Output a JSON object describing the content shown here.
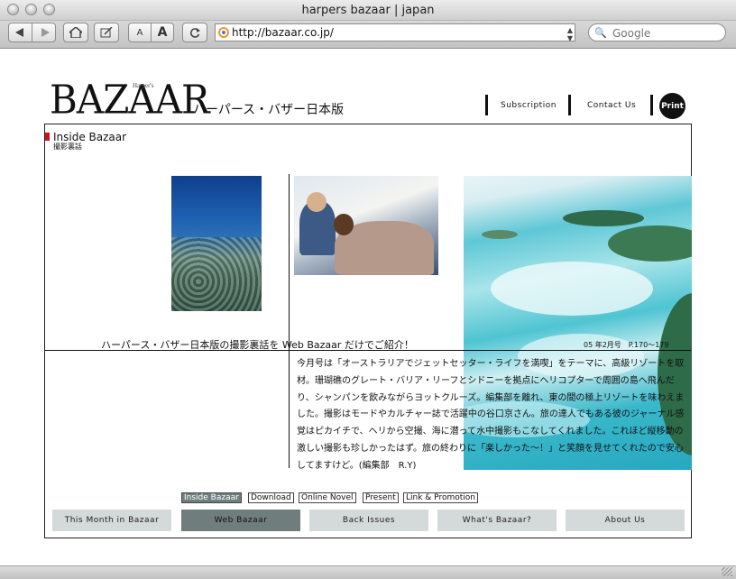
{
  "window": {
    "title": "harpers bazaar | japan"
  },
  "toolbar": {
    "back_icon": "back-arrow-icon",
    "forward_icon": "forward-arrow-icon",
    "font_smaller": "A",
    "font_larger": "A",
    "url": "http://bazaar.co.jp/",
    "search_placeholder": "Google"
  },
  "site": {
    "logo": "BAZAAR",
    "logo_small": "Harper's",
    "logo_japanese": "ハーパース・バザー日本版",
    "top_links": {
      "subscription": "Subscription",
      "contact": "Contact Us",
      "print": "Print"
    },
    "section": {
      "title": "Inside Bazaar",
      "subtitle": "撮影裏話"
    },
    "headline": "ハーパース・バザー日本版の撮影裏話を Web Bazaar だけでご紹介！",
    "issue": "05 年2月号　P.170〜179",
    "body": "今月号は「オーストラリアでジェットセッター・ライフを満喫」をテーマに、高級リゾートを取材。珊瑚礁のグレート・バリア・リーフとシドニーを拠点にヘリコプターで周囲の島へ飛んだり、シャンパンを飲みながらヨットクルーズ。編集部を離れ、東の間の極上リゾートを味わえました。撮影はモードやカルチャー誌で活躍中の谷口京さん。旅の達人でもある彼のジャーナル感覚はピカイチで、ヘリから空撮、海に潜って水中撮影もこなしてくれました。これほど縦移動の激しい撮影も珍しかったはず。旅の終わりに「楽しかった〜！」と笑顔を見せてくれたので安心してますけど。(編集部　R.Y)",
    "sub_nav": [
      "Inside Bazaar",
      "Download",
      "Online Novel",
      "Present",
      "Link & Promotion"
    ],
    "main_nav": [
      "This Month in Bazaar",
      "Web Bazaar",
      "Back Issues",
      "What's Bazaar?",
      "About Us"
    ],
    "accent_red": "#c8141e",
    "active_tab_color": "#6f7d7c"
  }
}
